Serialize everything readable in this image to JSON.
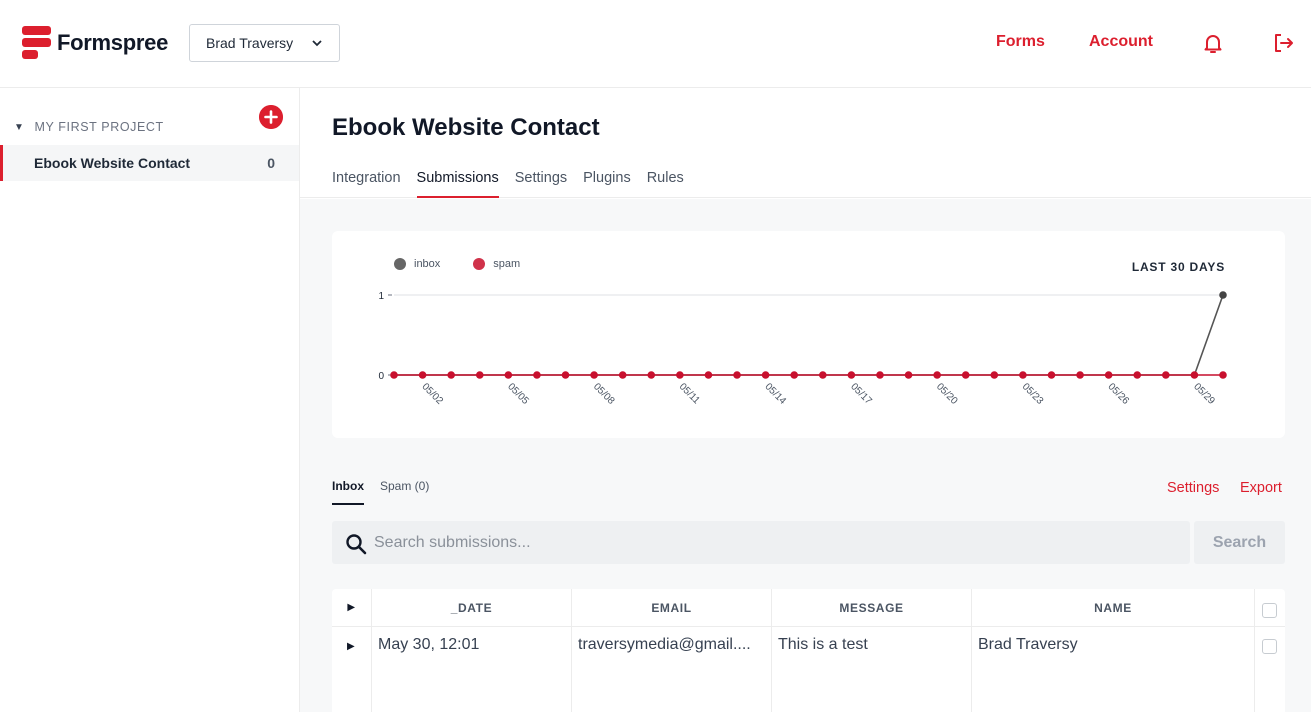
{
  "header": {
    "brand": "Formspree",
    "team": "Brad Traversy",
    "nav": {
      "forms": "Forms",
      "account": "Account"
    },
    "icons": [
      "bell-icon",
      "logout-icon"
    ]
  },
  "sidebar": {
    "project": "MY FIRST PROJECT",
    "forms": [
      {
        "name": "Ebook Website Contact",
        "count": "0"
      }
    ]
  },
  "main": {
    "title": "Ebook Website Contact",
    "tabs": [
      "Integration",
      "Submissions",
      "Settings",
      "Plugins",
      "Rules"
    ],
    "active_tab": "Submissions"
  },
  "chart_data": {
    "type": "line",
    "range_label": "LAST 30 DAYS",
    "legend": [
      "inbox",
      "spam"
    ],
    "x": [
      "05/01",
      "05/02",
      "05/03",
      "05/04",
      "05/05",
      "05/06",
      "05/07",
      "05/08",
      "05/09",
      "05/10",
      "05/11",
      "05/12",
      "05/13",
      "05/14",
      "05/15",
      "05/16",
      "05/17",
      "05/18",
      "05/19",
      "05/20",
      "05/21",
      "05/22",
      "05/23",
      "05/24",
      "05/25",
      "05/26",
      "05/27",
      "05/28",
      "05/29",
      "05/30"
    ],
    "tick_labels": [
      "05/02",
      "05/05",
      "05/08",
      "05/11",
      "05/14",
      "05/17",
      "05/20",
      "05/23",
      "05/26",
      "05/29"
    ],
    "y_ticks": [
      "0",
      "1"
    ],
    "ylim": [
      0,
      1
    ],
    "series": [
      {
        "name": "inbox",
        "color": "#555555",
        "values": [
          0,
          0,
          0,
          0,
          0,
          0,
          0,
          0,
          0,
          0,
          0,
          0,
          0,
          0,
          0,
          0,
          0,
          0,
          0,
          0,
          0,
          0,
          0,
          0,
          0,
          0,
          0,
          0,
          0,
          1
        ]
      },
      {
        "name": "spam",
        "color": "#c8102e",
        "values": [
          0,
          0,
          0,
          0,
          0,
          0,
          0,
          0,
          0,
          0,
          0,
          0,
          0,
          0,
          0,
          0,
          0,
          0,
          0,
          0,
          0,
          0,
          0,
          0,
          0,
          0,
          0,
          0,
          0,
          0
        ]
      }
    ]
  },
  "submissions": {
    "tabs": {
      "inbox": "Inbox",
      "spam": "Spam (0)"
    },
    "actions": {
      "settings": "Settings",
      "export": "Export"
    },
    "search": {
      "placeholder": "Search submissions...",
      "button": "Search"
    },
    "columns": [
      "_DATE",
      "EMAIL",
      "MESSAGE",
      "NAME"
    ],
    "rows": [
      {
        "date": "May 30, 12:01",
        "email": "traversymedia@gmail....",
        "message": "This is a test",
        "name": "Brad Traversy"
      }
    ]
  },
  "colors": {
    "accent": "#dc1f2e",
    "inbox": "#555555",
    "spam": "#c8102e"
  }
}
